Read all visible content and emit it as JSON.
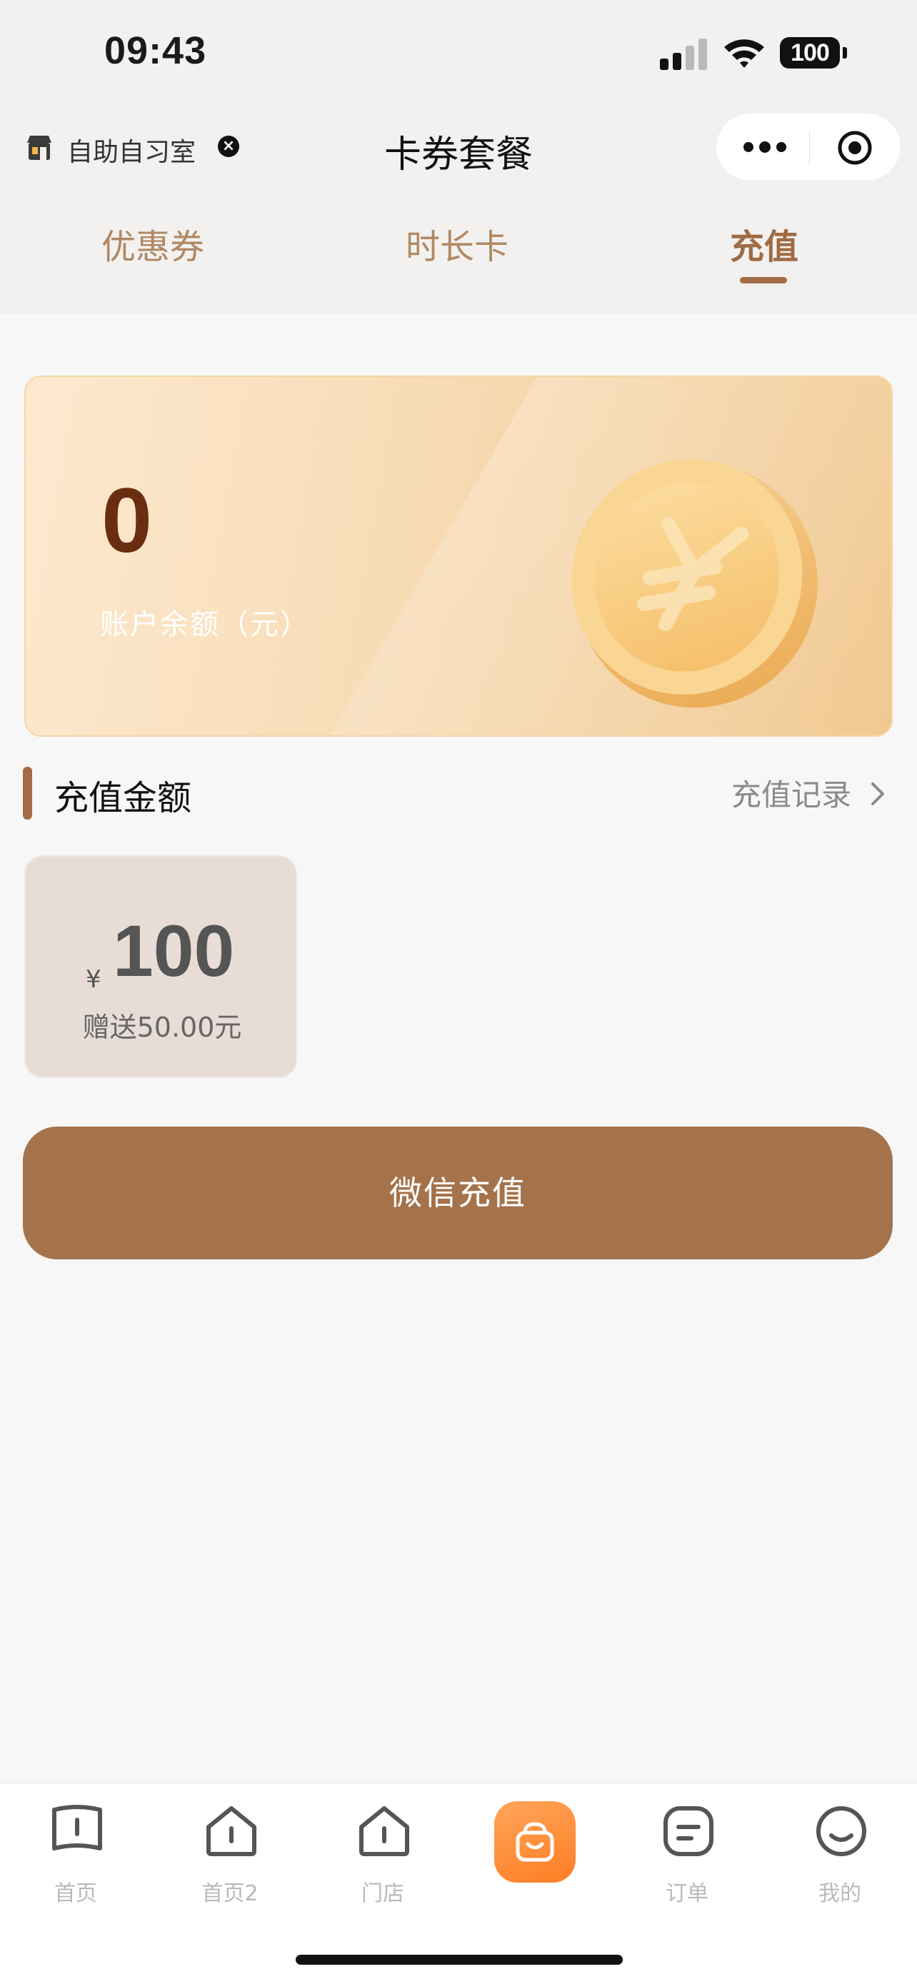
{
  "status_bar": {
    "time": "09:43",
    "battery": "100"
  },
  "nav": {
    "store_name": "自助自习室",
    "title": "卡券套餐"
  },
  "tabs": [
    {
      "label": "优惠券",
      "active": false
    },
    {
      "label": "时长卡",
      "active": false
    },
    {
      "label": "充值",
      "active": true
    }
  ],
  "balance": {
    "value": "0",
    "label": "账户余额（元）"
  },
  "section": {
    "title": "充值金额",
    "record_link": "充值记录"
  },
  "amount_option": {
    "currency": "¥",
    "value": "100",
    "bonus": "赠送50.00元"
  },
  "pay_button": {
    "label": "微信充值"
  },
  "tabbar": [
    {
      "label": "首页",
      "icon": "book-icon"
    },
    {
      "label": "首页2",
      "icon": "home-icon"
    },
    {
      "label": "门店",
      "icon": "home-icon"
    },
    {
      "label": "",
      "icon": "shopping-bag-icon"
    },
    {
      "label": "订单",
      "icon": "order-icon"
    },
    {
      "label": "我的",
      "icon": "smile-icon"
    }
  ],
  "colors": {
    "accent": "#a46c44",
    "center_tab": "#ff8a33",
    "card_gold": "#f0c88e"
  }
}
